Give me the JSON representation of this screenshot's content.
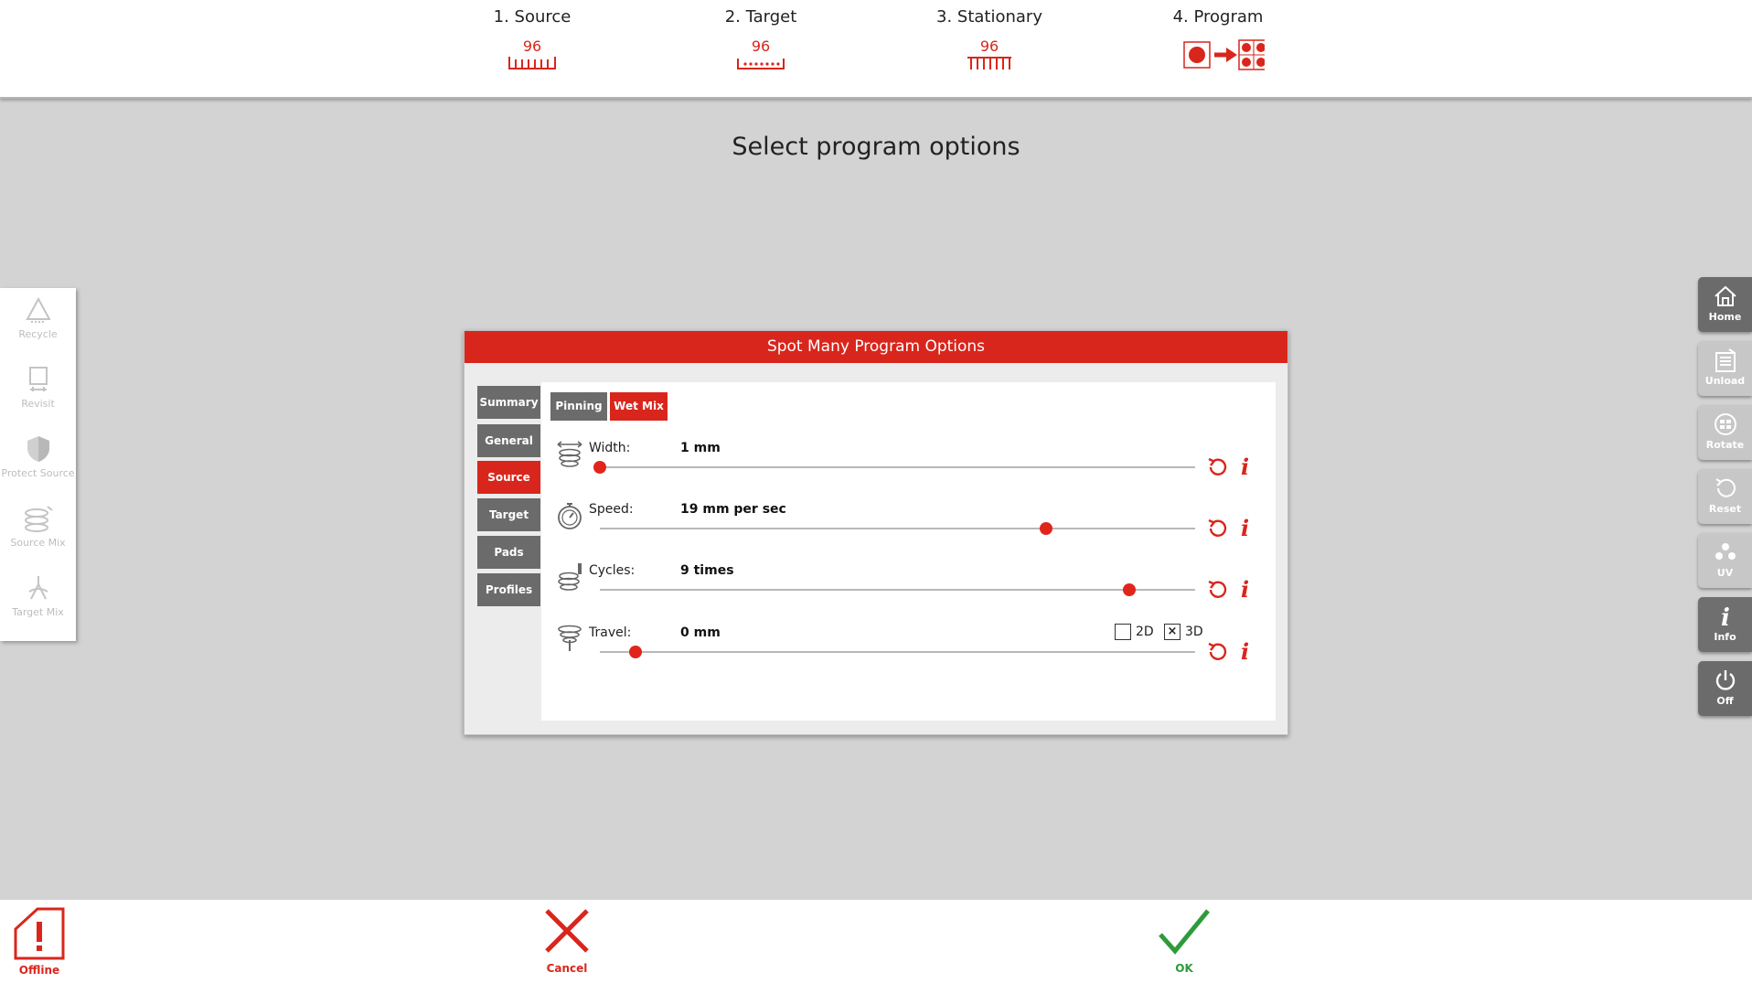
{
  "steps": [
    {
      "label": "1. Source",
      "count": "96"
    },
    {
      "label": "2. Target",
      "count": "96"
    },
    {
      "label": "3. Stationary",
      "count": "96"
    },
    {
      "label": "4. Program"
    }
  ],
  "page_title": "Select program options",
  "left_tools": [
    {
      "label": "Recycle",
      "icon": "recycle-icon"
    },
    {
      "label": "Revisit",
      "icon": "revisit-icon"
    },
    {
      "label": "Protect Source",
      "icon": "shield-icon"
    },
    {
      "label": "Source Mix",
      "icon": "source-mix-icon"
    },
    {
      "label": "Target Mix",
      "icon": "target-mix-icon"
    }
  ],
  "right_tools": [
    {
      "label": "Home",
      "icon": "home-icon"
    },
    {
      "label": "Unload",
      "icon": "unload-icon"
    },
    {
      "label": "Rotate",
      "icon": "rotate-icon"
    },
    {
      "label": "Reset",
      "icon": "reset-icon"
    },
    {
      "label": "UV",
      "icon": "uv-icon"
    },
    {
      "label": "Info",
      "icon": "info-icon"
    },
    {
      "label": "Off",
      "icon": "power-icon"
    }
  ],
  "dialog": {
    "title": "Spot Many Program Options",
    "side_tabs": [
      "Summary",
      "General",
      "Source",
      "Target",
      "Pads",
      "Profiles"
    ],
    "active_side_tab": "Source",
    "sub_tabs": [
      "Pinning",
      "Wet Mix"
    ],
    "active_sub_tab": "Wet Mix",
    "params": [
      {
        "label": "Width:",
        "value": "1 mm",
        "slider_fraction": 0.0
      },
      {
        "label": "Speed:",
        "value": "19 mm per sec",
        "slider_fraction": 0.75
      },
      {
        "label": "Cycles:",
        "value": "9 times",
        "slider_fraction": 0.89
      },
      {
        "label": "Travel:",
        "value": "0 mm",
        "slider_fraction": 0.06
      }
    ],
    "travel_modes": [
      {
        "label": "2D",
        "checked": false
      },
      {
        "label": "3D",
        "checked": true,
        "mark": "×"
      }
    ],
    "info_glyph": "i"
  },
  "bottom": {
    "offline_label": "Offline",
    "cancel_label": "Cancel",
    "ok_label": "OK"
  },
  "colors": {
    "accent": "#d9261c",
    "ok": "#2e9b3a",
    "tab_gray": "#6b6b6b",
    "background": "#d3d3d3"
  }
}
